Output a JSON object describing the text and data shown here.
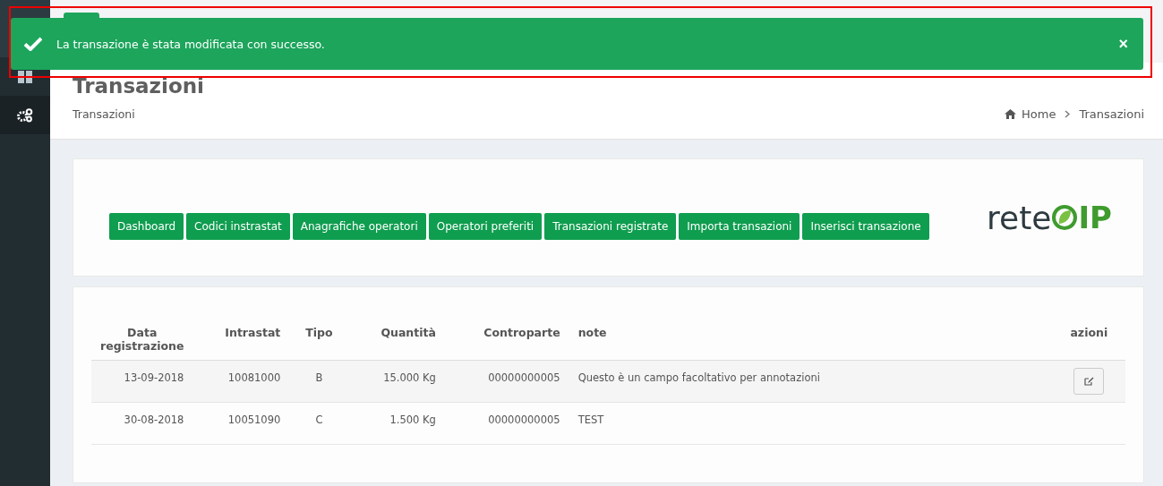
{
  "notification": {
    "message": "La transazione è stata modificata con successo.",
    "close": "×"
  },
  "page": {
    "title": "Transazioni",
    "subtitle": "Transazioni",
    "breadcrumb": [
      {
        "label": "Home",
        "kind": "home"
      },
      {
        "label": "Transazioni",
        "kind": "current"
      }
    ]
  },
  "nav_buttons": [
    "Dashboard",
    "Codici instrastat",
    "Anagrafiche operatori",
    "Operatori preferiti",
    "Transazioni registrate",
    "Importa transazioni",
    "Inserisci transazione"
  ],
  "logo": {
    "text_left": "rete",
    "text_right": "IP"
  },
  "table": {
    "columns": [
      "Data registrazione",
      "Intrastat",
      "Tipo",
      "Quantità",
      "Controparte",
      "note",
      "azioni"
    ],
    "rows": [
      {
        "cells": [
          "13-09-2018",
          "10081000",
          "B",
          "15.000 Kg",
          "00000000005",
          "Questo è un campo facoltativo per annotazioni"
        ],
        "editable": true
      },
      {
        "cells": [
          "30-08-2018",
          "10051090",
          "C",
          "1.500 Kg",
          "00000000005",
          "TEST"
        ],
        "editable": false
      }
    ]
  }
}
